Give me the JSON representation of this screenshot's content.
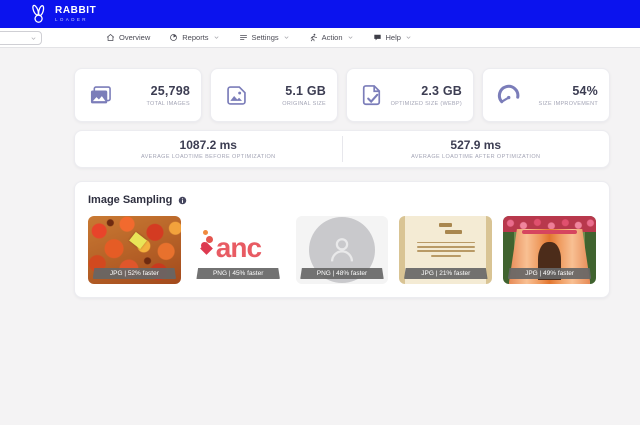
{
  "header": {
    "brand_top": "RABBIT",
    "brand_bottom": "LOADER"
  },
  "nav": {
    "site_select": {
      "value": ""
    },
    "items": [
      {
        "label": "Overview",
        "icon": "home-icon",
        "has_dropdown": false
      },
      {
        "label": "Reports",
        "icon": "pie-chart-icon",
        "has_dropdown": true
      },
      {
        "label": "Settings",
        "icon": "list-icon",
        "has_dropdown": true
      },
      {
        "label": "Action",
        "icon": "runner-icon",
        "has_dropdown": true
      },
      {
        "label": "Help",
        "icon": "chat-icon",
        "has_dropdown": true
      }
    ]
  },
  "stats": [
    {
      "value": "25,798",
      "label": "TOTAL IMAGES",
      "icon": "images-icon"
    },
    {
      "value": "5.1 GB",
      "label": "ORIGINAL SIZE",
      "icon": "image-file-icon"
    },
    {
      "value": "2.3 GB",
      "label": "OPTIMIZED SIZE (WEBP)",
      "icon": "file-check-icon"
    },
    {
      "value": "54%",
      "label": "SIZE IMPROVEMENT",
      "icon": "gauge-icon"
    }
  ],
  "loadtime": {
    "before": {
      "value": "1087.2 ms",
      "label": "AVERAGE LOADTIME BEFORE OPTIMIZATION"
    },
    "after": {
      "value": "527.9 ms",
      "label": "AVERAGE LOADTIME AFTER OPTIMIZATION"
    }
  },
  "sampling": {
    "title": "Image Sampling",
    "images": [
      {
        "badge": "JPG | 52% faster",
        "kind": "food-photo"
      },
      {
        "badge": "PNG | 45% faster",
        "kind": "logo-graphic",
        "logo_text": "anc"
      },
      {
        "badge": "PNG | 48% faster",
        "kind": "avatar-placeholder"
      },
      {
        "badge": "JPG | 21% faster",
        "kind": "invitation-card"
      },
      {
        "badge": "JPG | 49% faster",
        "kind": "wedding-mandap"
      }
    ]
  },
  "colors": {
    "brand_blue": "#0b13ee",
    "icon_purple": "#7b7db9",
    "page_bg": "#f4f3f4",
    "badge_gray": "#666666"
  }
}
